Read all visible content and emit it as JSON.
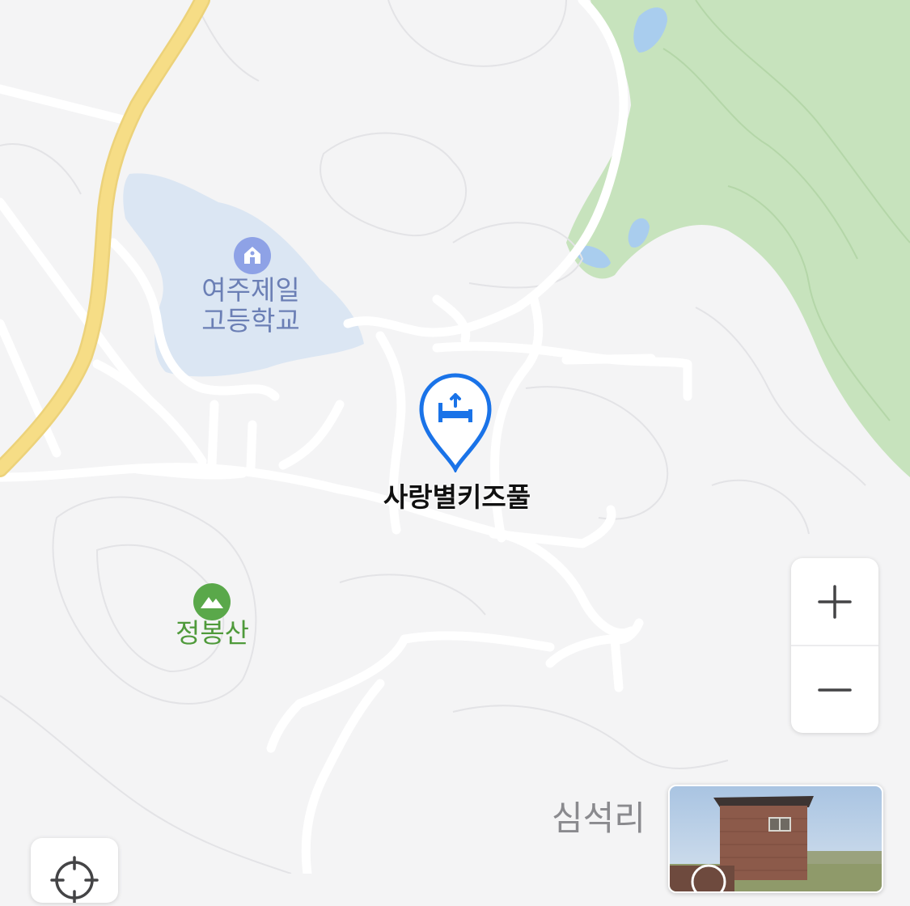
{
  "map": {
    "labels": {
      "school": "여주제일\n고등학교",
      "mountain": "정봉산",
      "poi": "사랑별키즈풀",
      "village": "심석리"
    },
    "icons": {
      "school": "school-icon",
      "mountain": "mountain-icon",
      "poi": "bed-lodging-pin-icon"
    },
    "colors": {
      "background": "#f4f4f5",
      "highway": "#f6dd86",
      "forest": "#c7e3bd",
      "water": "#a9cdee",
      "school_area": "#dbe6f3",
      "pin": "#1a73e8",
      "mountain_icon": "#5aa84a",
      "school_icon": "#8ea2e6"
    }
  },
  "controls": {
    "zoom_in_icon": "plus-icon",
    "zoom_out_icon": "minus-icon",
    "locate_icon": "crosshair-icon"
  },
  "photo_card": {
    "image": "brick-building-photo"
  }
}
